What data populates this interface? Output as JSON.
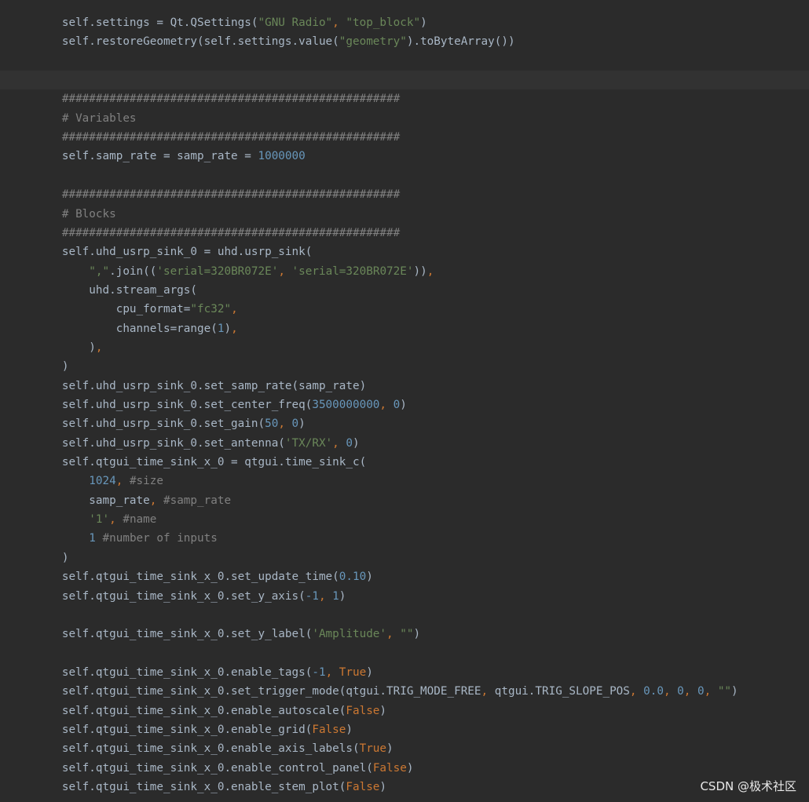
{
  "colors": {
    "background": "#2b2b2b",
    "current_line": "#323232",
    "identifier": "#a9b7c6",
    "string": "#6a8759",
    "number": "#6897bb",
    "keyword": "#cc7832",
    "comment": "#808080"
  },
  "code_lines": [
    [
      [
        "id",
        "        self.settings = Qt.QSettings("
      ],
      [
        "str",
        "\"GNU Radio\""
      ],
      [
        "punct",
        ", "
      ],
      [
        "str",
        "\"top_block\""
      ],
      [
        "id",
        ")"
      ]
    ],
    [
      [
        "id",
        "        self.restoreGeometry(self.settings.value("
      ],
      [
        "str",
        "\"geometry\""
      ],
      [
        "id",
        ").toByteArray())"
      ]
    ],
    [],
    [],
    [
      [
        "com",
        "        ##################################################"
      ]
    ],
    [
      [
        "com",
        "        # Variables"
      ]
    ],
    [
      [
        "com",
        "        ##################################################"
      ]
    ],
    [
      [
        "id",
        "        self.samp_rate = samp_rate = "
      ],
      [
        "num",
        "1000000"
      ]
    ],
    [],
    [
      [
        "com",
        "        ##################################################"
      ]
    ],
    [
      [
        "com",
        "        # Blocks"
      ]
    ],
    [
      [
        "com",
        "        ##################################################"
      ]
    ],
    [
      [
        "id",
        "        self.uhd_usrp_sink_0 = uhd.usrp_sink("
      ]
    ],
    [
      [
        "id",
        "            "
      ],
      [
        "str",
        "\",\""
      ],
      [
        "id",
        ".join(("
      ],
      [
        "str",
        "'serial=320BR072E'"
      ],
      [
        "punct",
        ", "
      ],
      [
        "str",
        "'serial=320BR072E'"
      ],
      [
        "id",
        "))"
      ],
      [
        "punct",
        ","
      ]
    ],
    [
      [
        "id",
        "            uhd.stream_args("
      ]
    ],
    [
      [
        "id",
        "                cpu_format="
      ],
      [
        "str",
        "\"fc32\""
      ],
      [
        "punct",
        ","
      ]
    ],
    [
      [
        "id",
        "                channels=range("
      ],
      [
        "num",
        "1"
      ],
      [
        "id",
        ")"
      ],
      [
        "punct",
        ","
      ]
    ],
    [
      [
        "id",
        "            )"
      ],
      [
        "punct",
        ","
      ]
    ],
    [
      [
        "id",
        "        )"
      ]
    ],
    [
      [
        "id",
        "        self.uhd_usrp_sink_0.set_samp_rate(samp_rate)"
      ]
    ],
    [
      [
        "id",
        "        self.uhd_usrp_sink_0.set_center_freq("
      ],
      [
        "num",
        "3500000000"
      ],
      [
        "punct",
        ", "
      ],
      [
        "num",
        "0"
      ],
      [
        "id",
        ")"
      ]
    ],
    [
      [
        "id",
        "        self.uhd_usrp_sink_0.set_gain("
      ],
      [
        "num",
        "50"
      ],
      [
        "punct",
        ", "
      ],
      [
        "num",
        "0"
      ],
      [
        "id",
        ")"
      ]
    ],
    [
      [
        "id",
        "        self.uhd_usrp_sink_0.set_antenna("
      ],
      [
        "str",
        "'TX/RX'"
      ],
      [
        "punct",
        ", "
      ],
      [
        "num",
        "0"
      ],
      [
        "id",
        ")"
      ]
    ],
    [
      [
        "id",
        "        self.qtgui_time_sink_x_0 = qtgui.time_sink_c("
      ]
    ],
    [
      [
        "id",
        "            "
      ],
      [
        "num",
        "1024"
      ],
      [
        "punct",
        ", "
      ],
      [
        "com",
        "#size"
      ]
    ],
    [
      [
        "id",
        "            samp_rate"
      ],
      [
        "punct",
        ", "
      ],
      [
        "com",
        "#samp_rate"
      ]
    ],
    [
      [
        "id",
        "            "
      ],
      [
        "str",
        "'1'"
      ],
      [
        "punct",
        ", "
      ],
      [
        "com",
        "#name"
      ]
    ],
    [
      [
        "id",
        "            "
      ],
      [
        "num",
        "1"
      ],
      [
        "id",
        " "
      ],
      [
        "com",
        "#number of inputs"
      ]
    ],
    [
      [
        "id",
        "        )"
      ]
    ],
    [
      [
        "id",
        "        self.qtgui_time_sink_x_0.set_update_time("
      ],
      [
        "num",
        "0.10"
      ],
      [
        "id",
        ")"
      ]
    ],
    [
      [
        "id",
        "        self.qtgui_time_sink_x_0.set_y_axis("
      ],
      [
        "num",
        "-1"
      ],
      [
        "punct",
        ", "
      ],
      [
        "num",
        "1"
      ],
      [
        "id",
        ")"
      ]
    ],
    [],
    [
      [
        "id",
        "        self.qtgui_time_sink_x_0.set_y_label("
      ],
      [
        "str",
        "'Amplitude'"
      ],
      [
        "punct",
        ", "
      ],
      [
        "str",
        "\"\""
      ],
      [
        "id",
        ")"
      ]
    ],
    [],
    [
      [
        "id",
        "        self.qtgui_time_sink_x_0.enable_tags("
      ],
      [
        "num",
        "-1"
      ],
      [
        "punct",
        ", "
      ],
      [
        "kw",
        "True"
      ],
      [
        "id",
        ")"
      ]
    ],
    [
      [
        "id",
        "        self.qtgui_time_sink_x_0.set_trigger_mode(qtgui.TRIG_MODE_FREE"
      ],
      [
        "punct",
        ", "
      ],
      [
        "id",
        "qtgui.TRIG_SLOPE_POS"
      ],
      [
        "punct",
        ", "
      ],
      [
        "num",
        "0.0"
      ],
      [
        "punct",
        ", "
      ],
      [
        "num",
        "0"
      ],
      [
        "punct",
        ", "
      ],
      [
        "num",
        "0"
      ],
      [
        "punct",
        ", "
      ],
      [
        "str",
        "\"\""
      ],
      [
        "id",
        ")"
      ]
    ],
    [
      [
        "id",
        "        self.qtgui_time_sink_x_0.enable_autoscale("
      ],
      [
        "kw",
        "False"
      ],
      [
        "id",
        ")"
      ]
    ],
    [
      [
        "id",
        "        self.qtgui_time_sink_x_0.enable_grid("
      ],
      [
        "kw",
        "False"
      ],
      [
        "id",
        ")"
      ]
    ],
    [
      [
        "id",
        "        self.qtgui_time_sink_x_0.enable_axis_labels("
      ],
      [
        "kw",
        "True"
      ],
      [
        "id",
        ")"
      ]
    ],
    [
      [
        "id",
        "        self.qtgui_time_sink_x_0.enable_control_panel("
      ],
      [
        "kw",
        "False"
      ],
      [
        "id",
        ")"
      ]
    ],
    [
      [
        "id",
        "        self.qtgui_time_sink_x_0.enable_stem_plot("
      ],
      [
        "kw",
        "False"
      ],
      [
        "id",
        ")"
      ]
    ]
  ],
  "current_line_index": 3,
  "watermark": "CSDN @极术社区"
}
